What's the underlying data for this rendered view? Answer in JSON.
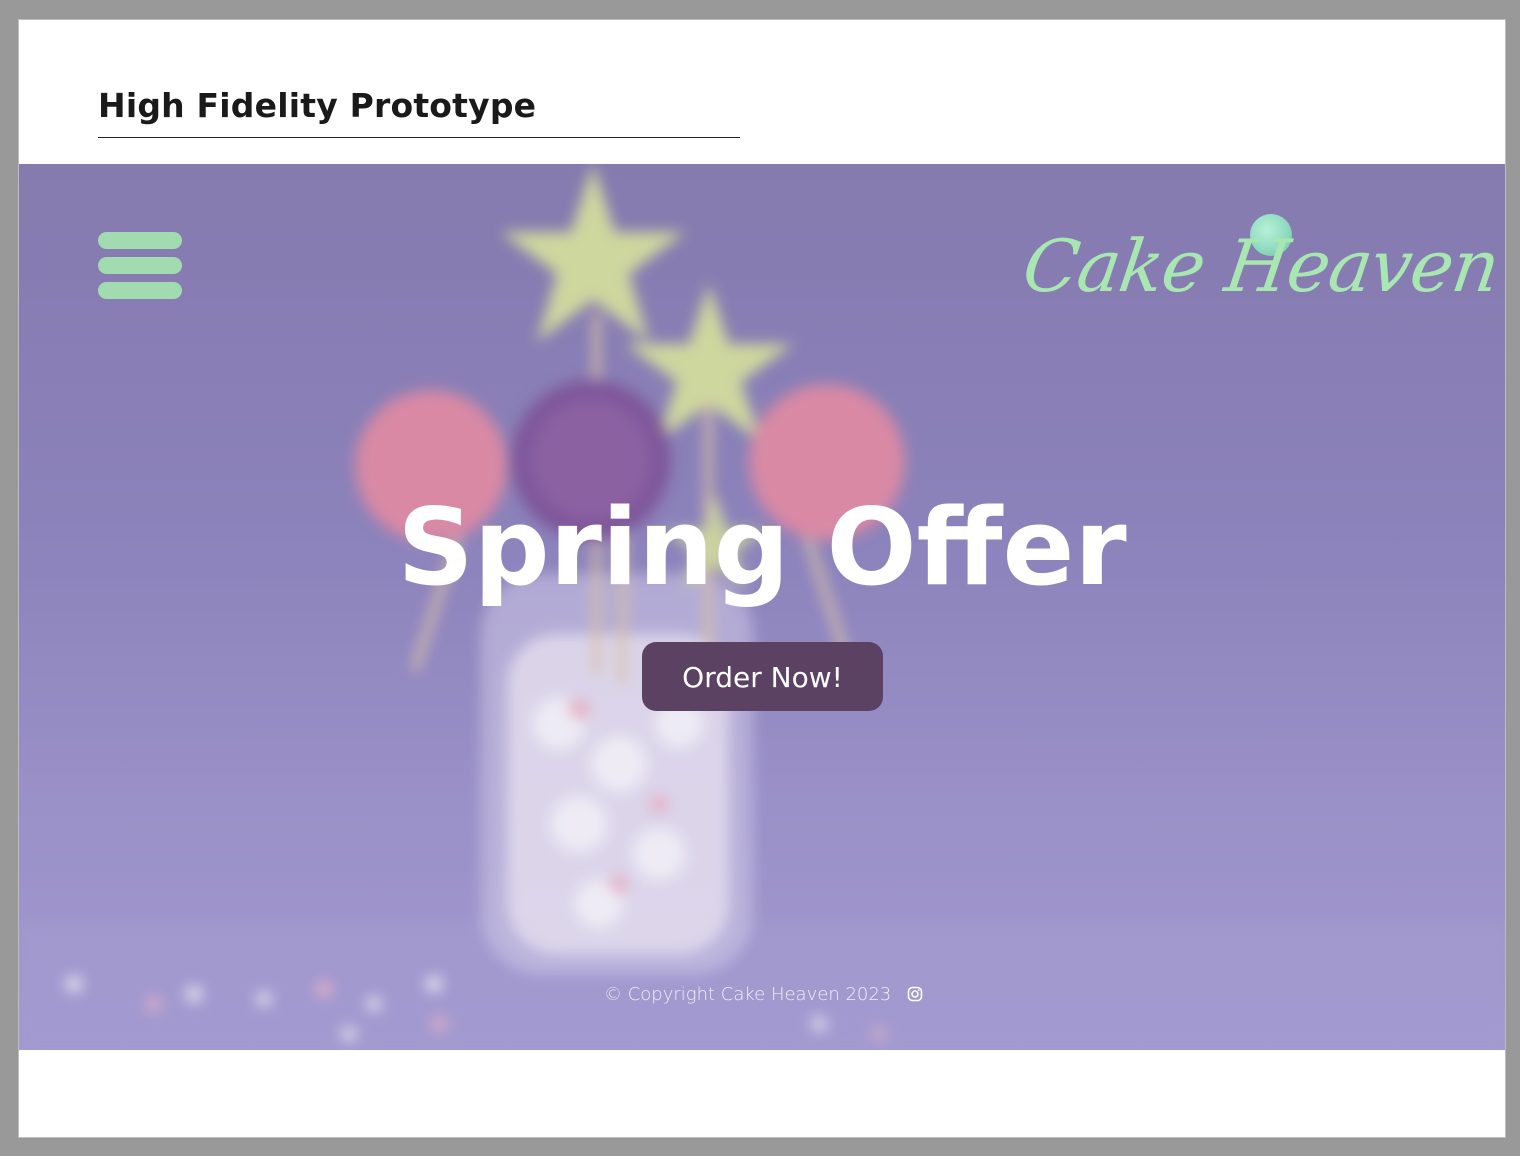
{
  "document": {
    "title": "High Fidelity Prototype"
  },
  "brand": {
    "logo_text": "Cake Heaven",
    "accent_color": "#a3dbb1",
    "button_color": "#5b4262",
    "hero_color": "#8c82bb"
  },
  "nav": {
    "menu_icon": "hamburger-menu-icon"
  },
  "hero": {
    "headline": "Spring Offer",
    "cta_label": "Order Now!"
  },
  "footer": {
    "copyright": "© Copyright Cake Heaven 2023",
    "social_icon": "instagram-icon"
  }
}
